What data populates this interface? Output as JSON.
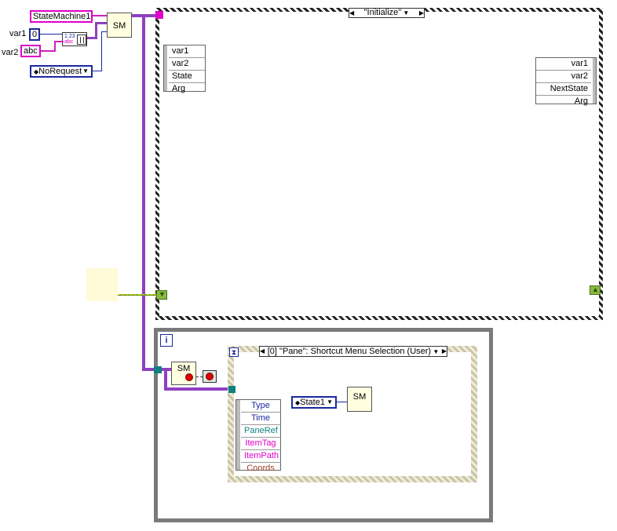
{
  "controls": {
    "state_machine": "StateMachine1",
    "var1_label": "var1",
    "var1_value": "0",
    "var2_label": "var2",
    "var2_value": "abc",
    "request_enum": "NoRequest",
    "bundle_icon": "bundle-icon",
    "bundle_top": "1.23",
    "bundle_bottom": "abc"
  },
  "sm_nodes": {
    "top": "SM",
    "loop": "SM",
    "inner": "SM"
  },
  "case_structure": {
    "selector": "\"Initialize\"",
    "left_tunnel": [
      "var1",
      "var2",
      "State",
      "Arg"
    ],
    "right_tunnel": [
      "var1",
      "var2",
      "NextState",
      "Arg"
    ]
  },
  "while_loop": {
    "iteration": "i"
  },
  "event_structure": {
    "selector": "[0] \"Pane\": Shortcut Menu Selection (User)",
    "event_data": [
      "Type",
      "Time",
      "PaneRef",
      "ItemTag",
      "ItemPath",
      "Coords"
    ],
    "event_data_colors": [
      "#1a28a0",
      "#1a28a0",
      "#108080",
      "#e000c8",
      "#e000c8",
      "#a04030"
    ],
    "state_enum": "State1"
  },
  "colors": {
    "string_wire": "#e000c8",
    "cluster_wire": "#9040c0",
    "enum_blue": "#1a28a0",
    "boolean_green": "#6a9a20"
  }
}
